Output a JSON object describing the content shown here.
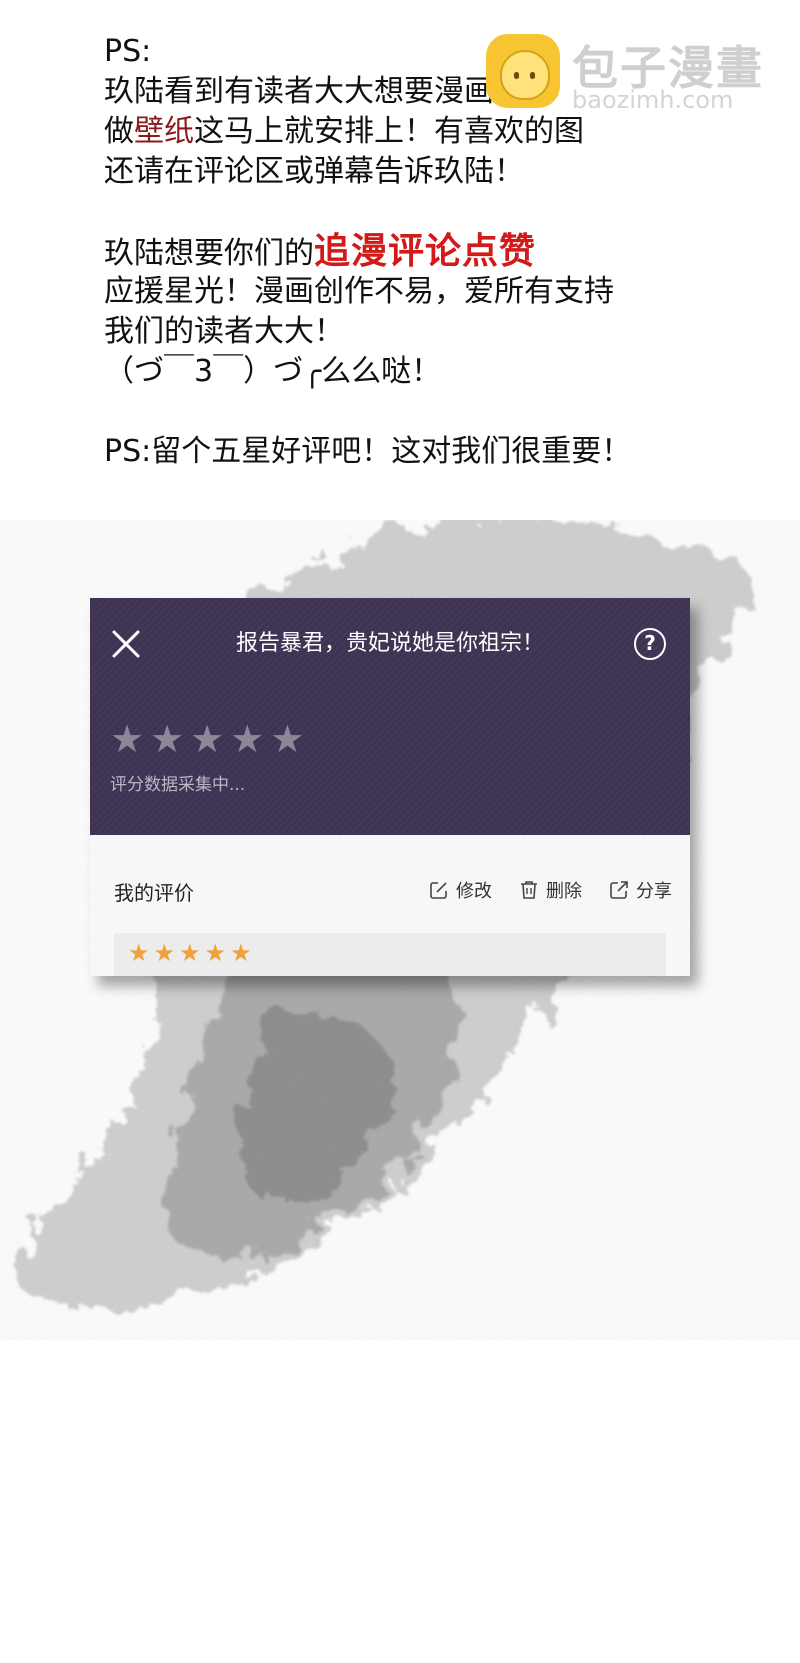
{
  "watermark": {
    "title": "包子漫畫",
    "url": "baozimh.com"
  },
  "note": {
    "lines": [
      "PS:",
      "玖陆看到有读者大大想要漫画截图",
      {
        "before": "做",
        "highlight": "壁纸",
        "after": "这马上就安排上！有喜欢的图"
      },
      "还请在评论区或弹幕告诉玖陆！",
      "",
      {
        "before": "玖陆想要你们的",
        "emphasis": "追漫评论点赞"
      },
      "应援星光！漫画创作不易，爱所有支持",
      "我们的读者大大！",
      "（づ￣3￣）づ╭么么哒！",
      "",
      "PS:留个五星好评吧！这对我们很重要！"
    ]
  },
  "card": {
    "title": "报告暴君，贵妃说她是你祖宗！",
    "help_glyph": "?",
    "rating_status": "评分数据采集中...",
    "average_stars": 0,
    "my_rating_label": "我的评价",
    "actions": {
      "edit": "修改",
      "delete": "删除",
      "share": "分享"
    },
    "my_stars": 5
  },
  "colors": {
    "header_bg": "#3f3354",
    "star_grey": "#8d8696",
    "star_orange": "#f0a13a",
    "highlight_text": "#8b1a1a",
    "emphasis_text": "#d21a1a"
  }
}
